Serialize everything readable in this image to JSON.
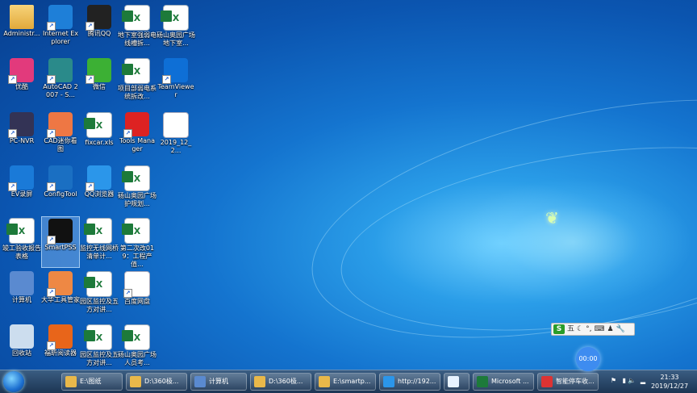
{
  "desktop": {
    "icons": [
      {
        "label": "Administr...",
        "icon": "user-folder-icon"
      },
      {
        "label": "Internet Explorer",
        "icon": "ie-icon"
      },
      {
        "label": "腾讯QQ",
        "icon": "qq-icon"
      },
      {
        "label": "地下室强弱电线槽拆...",
        "icon": "excel-icon"
      },
      {
        "label": "砀山奥园广场地下室...",
        "icon": "excel-icon"
      },
      {
        "label": "优酷",
        "icon": "youku-icon"
      },
      {
        "label": "AutoCAD 2007 - S...",
        "icon": "autocad-icon"
      },
      {
        "label": "微信",
        "icon": "wechat-icon"
      },
      {
        "label": "项目部弱电系统拆改...",
        "icon": "excel-icon"
      },
      {
        "label": "TeamViewer",
        "icon": "teamviewer-icon"
      },
      {
        "label": "PC-NVR",
        "icon": "pcnvr-icon"
      },
      {
        "label": "CAD迷你看图",
        "icon": "cad-viewer-icon"
      },
      {
        "label": "fixcar.xls",
        "icon": "excel-icon"
      },
      {
        "label": "Tools Manager",
        "icon": "tools-manager-icon"
      },
      {
        "label": "2019_12_2...",
        "icon": "blank-file-icon"
      },
      {
        "label": "EV录屏",
        "icon": "ev-recorder-icon"
      },
      {
        "label": "ConfigTool",
        "icon": "configtool-icon"
      },
      {
        "label": "QQ浏览器",
        "icon": "qq-browser-icon"
      },
      {
        "label": "砀山奥园广场护规划...",
        "icon": "excel-icon"
      },
      {
        "label": "竣工验收报告表格",
        "icon": "excel-icon"
      },
      {
        "label": "SmartPSS",
        "icon": "smartpss-icon"
      },
      {
        "label": "监控无线网桥清单计...",
        "icon": "excel-icon"
      },
      {
        "label": "第二次改019：工程产值...",
        "icon": "excel-icon"
      },
      {
        "label": "计算机",
        "icon": "computer-icon"
      },
      {
        "label": "大华工具管家",
        "icon": "dahua-tools-icon"
      },
      {
        "label": "园区监控及五方对讲...",
        "icon": "excel-icon"
      },
      {
        "label": "百度网盘",
        "icon": "baidu-netdisk-icon"
      },
      {
        "label": "回收站",
        "icon": "recycle-bin-icon"
      },
      {
        "label": "福昕阅读器",
        "icon": "foxit-reader-icon"
      },
      {
        "label": "园区监控及五方对讲...",
        "icon": "excel-icon"
      },
      {
        "label": "砀山奥园广场人员考...",
        "icon": "excel-icon"
      }
    ]
  },
  "taskbar": {
    "start_icon": "windows-start-icon",
    "buttons": [
      {
        "label": "E:\\图纸",
        "icon": "folder-icon"
      },
      {
        "label": "D:\\360极...",
        "icon": "folder-icon"
      },
      {
        "label": "计算机",
        "icon": "computer-icon"
      },
      {
        "label": "D:\\360极...",
        "icon": "folder-icon"
      },
      {
        "label": "E:\\smartp...",
        "icon": "folder-icon"
      },
      {
        "label": "http://192...",
        "icon": "qq-browser-icon"
      },
      {
        "label": "",
        "icon": "baidu-netdisk-icon"
      },
      {
        "label": "Microsoft ...",
        "icon": "excel-icon"
      },
      {
        "label": "智能停车收...",
        "icon": "chrome-icon"
      }
    ],
    "clock": {
      "time": "21:33",
      "date": "2019/12/27"
    }
  },
  "ime_bar": {
    "logo": "S",
    "mode": "五"
  },
  "recording_timer": "00:00",
  "colors": {
    "accent": "#1474cf",
    "excel_green": "#1d7a3a"
  }
}
